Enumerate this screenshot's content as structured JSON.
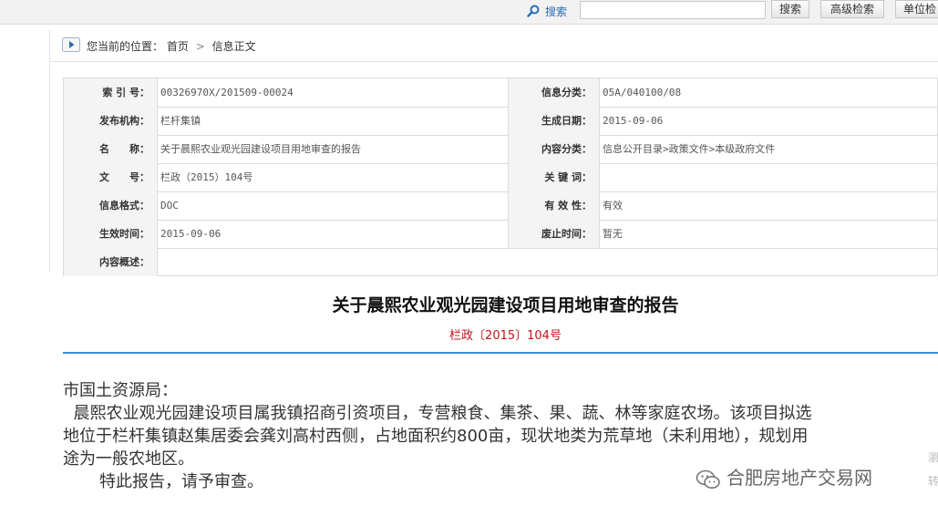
{
  "toolbar": {
    "search_label": "搜索",
    "search_value": "",
    "search_button": "搜索",
    "advanced_button": "高级检索",
    "unit_button": "单位检"
  },
  "breadcrumb": {
    "prefix": "您当前的位置：",
    "home": "首页",
    "separator": ">",
    "current": "信息正文"
  },
  "meta": {
    "rows": [
      {
        "label1": "索 引 号：",
        "value1": "00326970X/201509-00024",
        "label2": "信息分类：",
        "value2": "05A/040100/08"
      },
      {
        "label1": "发布机构：",
        "value1": "栏杆集镇",
        "label2": "生成日期：",
        "value2": "2015-09-06"
      },
      {
        "label1": "名　　称：",
        "value1": "关于晨熙农业观光园建设项目用地审查的报告",
        "label2": "内容分类：",
        "value2": "信息公开目录>政策文件>本级政府文件"
      },
      {
        "label1": "文　　号：",
        "value1": "栏政（2015）104号",
        "label2": "关 键 词：",
        "value2": ""
      },
      {
        "label1": "信息格式：",
        "value1": "DOC",
        "label2": "有 效 性：",
        "value2": "有效"
      },
      {
        "label1": "生效时间：",
        "value1": "2015-09-06",
        "label2": "废止时间：",
        "value2": "暂无"
      },
      {
        "label1": "内容概述：",
        "value1": "",
        "label2": "",
        "value2": ""
      }
    ]
  },
  "document": {
    "title": "关于晨熙农业观光园建设项目用地审查的报告",
    "number": "栏政〔2015〕104号",
    "salutation": "市国土资源局：",
    "line1": "  晨熙农业观光园建设项目属我镇招商引资项目，专营粮食、集茶、果、蔬、林等家庭农场。该项目拟选",
    "line2": "地位于栏杆集镇赵集居委会龚刘高村西侧，占地面积约800亩，现状地类为荒草地（未利用地），规划用",
    "line3": "途为一般农地区。",
    "closing": "       特此报告，请予审查。"
  },
  "watermark": {
    "text": "合肥房地产交易网",
    "icon": "wechat-icon",
    "edge_chars": [
      "瀏",
      "转"
    ]
  },
  "colors": {
    "accent_blue": "#3b8fd5",
    "doc_number_red": "#c0141b"
  }
}
